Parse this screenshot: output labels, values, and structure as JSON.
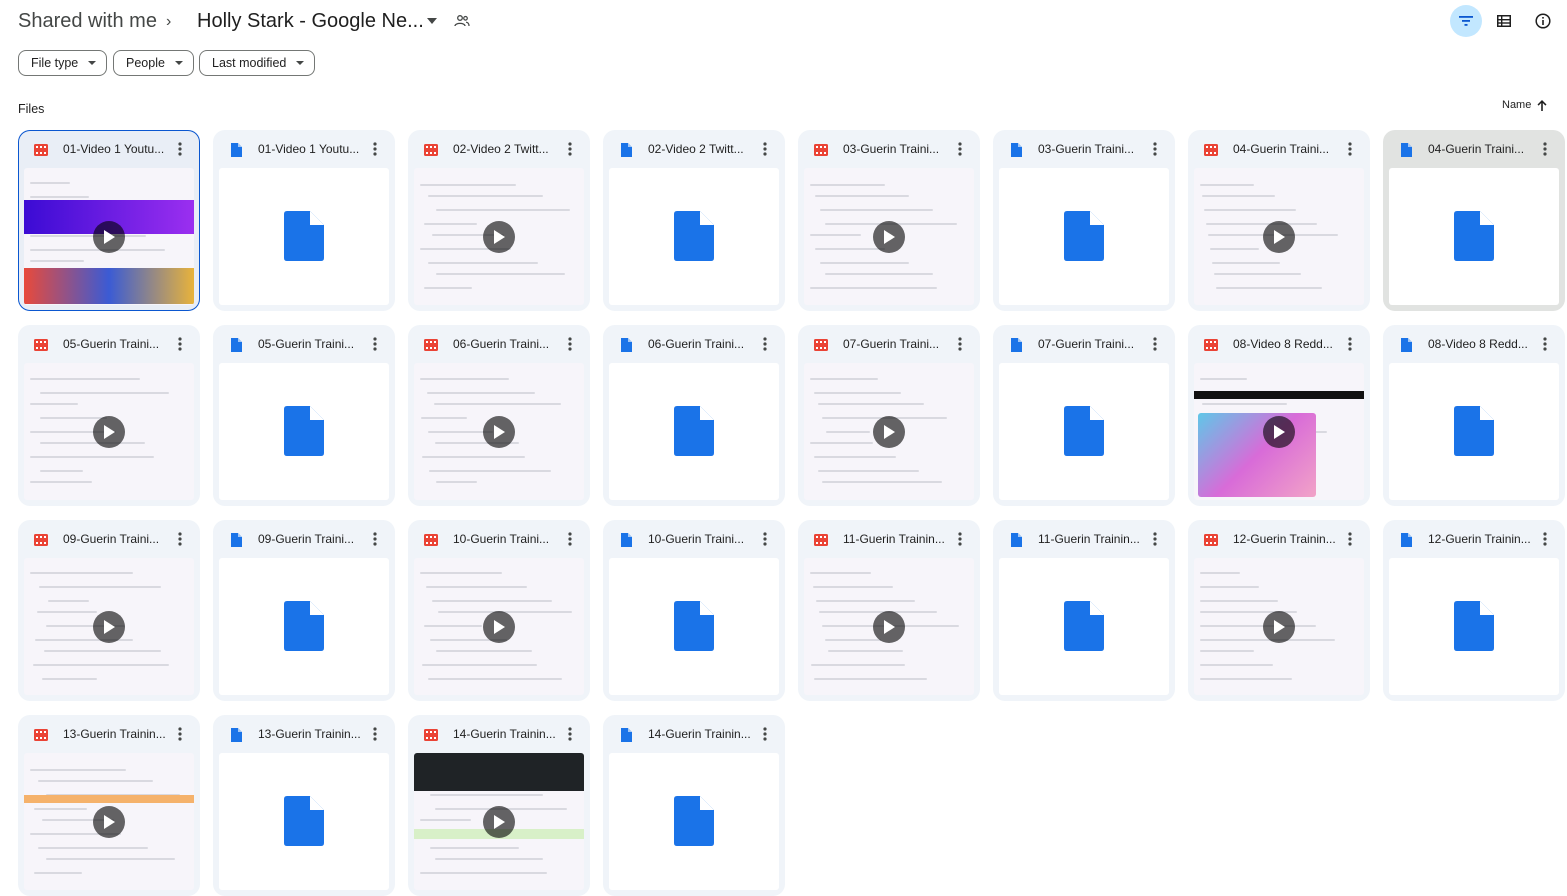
{
  "breadcrumb": {
    "root": "Shared with me",
    "separator": "›",
    "current": "Holly Stark - Google Ne..."
  },
  "filters": [
    {
      "label": "File type"
    },
    {
      "label": "People"
    },
    {
      "label": "Last modified"
    }
  ],
  "section_title": "Files",
  "sort": {
    "label": "Name"
  },
  "colors": {
    "video": "#ea4335",
    "doc": "#1a73e8",
    "accent": "#0b57d0",
    "card": "#f0f4f9"
  },
  "files": [
    {
      "name": "01-Video 1 Youtu...",
      "kind": "video",
      "selected": true
    },
    {
      "name": "01-Video 1 Youtu...",
      "kind": "doc"
    },
    {
      "name": "02-Video 2 Twitt...",
      "kind": "video"
    },
    {
      "name": "02-Video 2 Twitt...",
      "kind": "doc"
    },
    {
      "name": "03-Guerin Traini...",
      "kind": "video"
    },
    {
      "name": "03-Guerin Traini...",
      "kind": "doc"
    },
    {
      "name": "04-Guerin Traini...",
      "kind": "video"
    },
    {
      "name": "04-Guerin Traini...",
      "kind": "doc",
      "hover": true
    },
    {
      "name": "05-Guerin Traini...",
      "kind": "video"
    },
    {
      "name": "05-Guerin Traini...",
      "kind": "doc"
    },
    {
      "name": "06-Guerin Traini...",
      "kind": "video"
    },
    {
      "name": "06-Guerin Traini...",
      "kind": "doc"
    },
    {
      "name": "07-Guerin Traini...",
      "kind": "video"
    },
    {
      "name": "07-Guerin Traini...",
      "kind": "doc"
    },
    {
      "name": "08-Video 8 Redd...",
      "kind": "video"
    },
    {
      "name": "08-Video 8 Redd...",
      "kind": "doc"
    },
    {
      "name": "09-Guerin Traini...",
      "kind": "video"
    },
    {
      "name": "09-Guerin Traini...",
      "kind": "doc"
    },
    {
      "name": "10-Guerin Traini...",
      "kind": "video"
    },
    {
      "name": "10-Guerin Traini...",
      "kind": "doc"
    },
    {
      "name": "11-Guerin Trainin...",
      "kind": "video"
    },
    {
      "name": "11-Guerin Trainin...",
      "kind": "doc"
    },
    {
      "name": "12-Guerin Trainin...",
      "kind": "video"
    },
    {
      "name": "12-Guerin Trainin...",
      "kind": "doc"
    },
    {
      "name": "13-Guerin Trainin...",
      "kind": "video"
    },
    {
      "name": "13-Guerin Trainin...",
      "kind": "doc"
    },
    {
      "name": "14-Guerin Trainin...",
      "kind": "video"
    },
    {
      "name": "14-Guerin Trainin...",
      "kind": "doc"
    }
  ]
}
